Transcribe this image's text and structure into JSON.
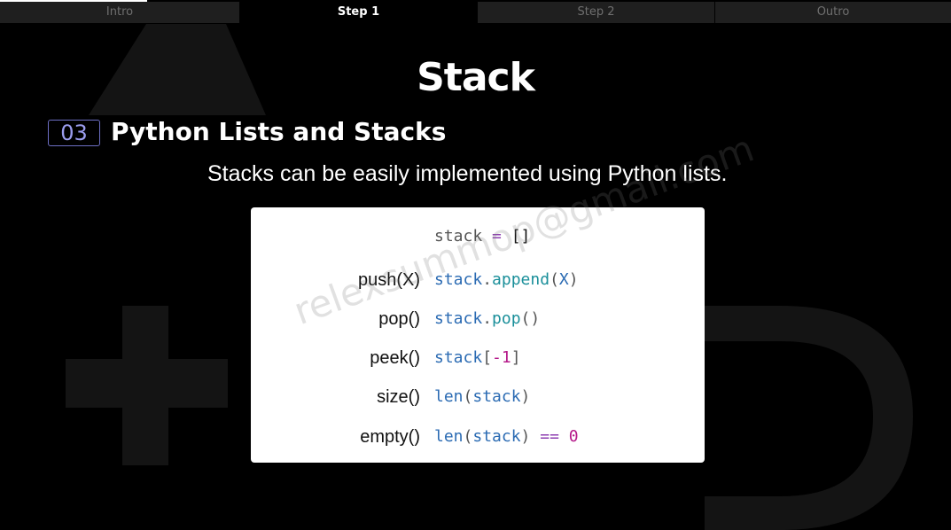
{
  "tabs": [
    {
      "label": "Intro",
      "active": false
    },
    {
      "label": "Step 1",
      "active": true
    },
    {
      "label": "Step 2",
      "active": false
    },
    {
      "label": "Outro",
      "active": false
    }
  ],
  "slide": {
    "title": "Stack",
    "section_number": "03",
    "section_title": "Python Lists and Stacks",
    "subtitle": "Stacks can be easily implemented using Python lists."
  },
  "code": {
    "init": {
      "var": "stack",
      "eq": " = ",
      "val": "[]"
    },
    "ops": [
      {
        "op": "push(X)",
        "tokens": [
          [
            "k",
            "stack"
          ],
          [
            "p",
            "."
          ],
          [
            "m",
            "append"
          ],
          [
            "p",
            "("
          ],
          [
            "k",
            "X"
          ],
          [
            "p",
            ")"
          ]
        ]
      },
      {
        "op": "pop()",
        "tokens": [
          [
            "k",
            "stack"
          ],
          [
            "p",
            "."
          ],
          [
            "m",
            "pop"
          ],
          [
            "p",
            "()"
          ]
        ]
      },
      {
        "op": "peek()",
        "tokens": [
          [
            "k",
            "stack"
          ],
          [
            "p",
            "["
          ],
          [
            "n",
            "-1"
          ],
          [
            "p",
            "]"
          ]
        ]
      },
      {
        "op": "size()",
        "tokens": [
          [
            "k",
            "len"
          ],
          [
            "p",
            "("
          ],
          [
            "k",
            "stack"
          ],
          [
            "p",
            ")"
          ]
        ]
      },
      {
        "op": "empty()",
        "tokens": [
          [
            "k",
            "len"
          ],
          [
            "p",
            "("
          ],
          [
            "k",
            "stack"
          ],
          [
            "p",
            ") "
          ],
          [
            "o",
            "=="
          ],
          [
            "p",
            " "
          ],
          [
            "n",
            "0"
          ]
        ]
      }
    ]
  },
  "watermark": "relexsummop@gmail.com",
  "colors": {
    "accent": "#9b9dee",
    "tab_inactive_bg": "#1f1f1f",
    "card_bg": "#ffffff"
  }
}
